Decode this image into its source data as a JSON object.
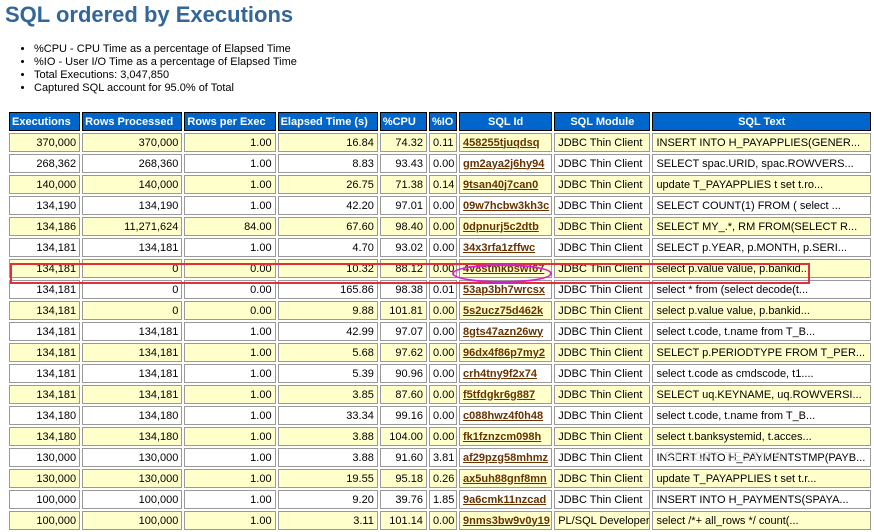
{
  "title": "SQL ordered by Executions",
  "notes": [
    "%CPU - CPU Time as a percentage of Elapsed Time",
    "%IO - User I/O Time as a percentage of Elapsed Time",
    "Total Executions: 3,047,850",
    "Captured SQL account for 95.0% of Total"
  ],
  "columns": [
    "Executions",
    "Rows Processed",
    "Rows per Exec",
    "Elapsed Time (s)",
    "%CPU",
    "%IO",
    "SQL Id",
    "SQL Module",
    "SQL Text"
  ],
  "rows": [
    [
      "370,000",
      "370,000",
      "1.00",
      "16.84",
      "74.32",
      "0.11",
      "458255tjuqdsq",
      "JDBC Thin Client",
      "INSERT INTO H_PAYAPPLIES(GENER..."
    ],
    [
      "268,362",
      "268,360",
      "1.00",
      "8.83",
      "93.43",
      "0.00",
      "gm2aya2j6hy94",
      "JDBC Thin Client",
      "SELECT spac.URID, spac.ROWVERS..."
    ],
    [
      "140,000",
      "140,000",
      "1.00",
      "26.75",
      "71.38",
      "0.14",
      "9tsan40j7can0",
      "JDBC Thin Client",
      "update T_PAYAPPLIES t set t.ro..."
    ],
    [
      "134,190",
      "134,190",
      "1.00",
      "42.20",
      "97.01",
      "0.00",
      "09w7hcbw3kh3c",
      "JDBC Thin Client",
      "SELECT COUNT(1) FROM ( select ..."
    ],
    [
      "134,186",
      "11,271,624",
      "84.00",
      "67.60",
      "98.40",
      "0.00",
      "0dpnurj5c2dtb",
      "JDBC Thin Client",
      "SELECT MY_.*, RM FROM(SELECT R..."
    ],
    [
      "134,181",
      "134,181",
      "1.00",
      "4.70",
      "93.02",
      "0.00",
      "34x3rfa1zffwc",
      "JDBC Thin Client",
      "SELECT p.YEAR, p.MONTH, p.SERI..."
    ],
    [
      "134,181",
      "0",
      "0.00",
      "10.32",
      "88.12",
      "0.00",
      "4v8stmkbswf67",
      "JDBC Thin Client",
      "select p.value value, p.bankid..."
    ],
    [
      "134,181",
      "0",
      "0.00",
      "165.86",
      "98.38",
      "0.01",
      "53ap3bh7wrcsx",
      "JDBC Thin Client",
      "select * from (select decode(t..."
    ],
    [
      "134,181",
      "0",
      "0.00",
      "9.88",
      "101.81",
      "0.00",
      "5s2ucz75d462k",
      "JDBC Thin Client",
      "select p.value value, p.bankid..."
    ],
    [
      "134,181",
      "134,181",
      "1.00",
      "42.99",
      "97.07",
      "0.00",
      "8gts47azn26wy",
      "JDBC Thin Client",
      "select t.code, t.name from T_B..."
    ],
    [
      "134,181",
      "134,181",
      "1.00",
      "5.68",
      "97.62",
      "0.00",
      "96dx4f86p7my2",
      "JDBC Thin Client",
      "SELECT p.PERIODTYPE FROM T_PER..."
    ],
    [
      "134,181",
      "134,181",
      "1.00",
      "5.39",
      "90.96",
      "0.00",
      "crh4tny9f2x74",
      "JDBC Thin Client",
      "select t.code as cmdscode, t1...."
    ],
    [
      "134,181",
      "134,181",
      "1.00",
      "3.85",
      "87.60",
      "0.00",
      "f5tfdgkr6g887",
      "JDBC Thin Client",
      "SELECT uq.KEYNAME, uq.ROWVERSI..."
    ],
    [
      "134,180",
      "134,180",
      "1.00",
      "33.34",
      "99.16",
      "0.00",
      "c088hwz4f0h48",
      "JDBC Thin Client",
      "select t.code, t.name from T_B..."
    ],
    [
      "134,180",
      "134,180",
      "1.00",
      "3.88",
      "104.00",
      "0.00",
      "fk1fznzcm098h",
      "JDBC Thin Client",
      "select t.banksystemid, t.acces..."
    ],
    [
      "130,000",
      "130,000",
      "1.00",
      "3.88",
      "91.60",
      "3.81",
      "af29pzg58mhmz",
      "JDBC Thin Client",
      "INSERT INTO H_PAYMENTSTMP(PAYB..."
    ],
    [
      "130,000",
      "130,000",
      "1.00",
      "19.55",
      "95.18",
      "0.26",
      "ax5uh88gnf8mn",
      "JDBC Thin Client",
      "update T_PAYAPPLIES t set t.r..."
    ],
    [
      "100,000",
      "100,000",
      "1.00",
      "9.20",
      "39.76",
      "1.85",
      "9a6cmk11nzcad",
      "JDBC Thin Client",
      "INSERT INTO H_PAYMENTS(SPAYA..."
    ],
    [
      "100,000",
      "100,000",
      "1.00",
      "3.11",
      "101.14",
      "0.00",
      "9nms3bw9v0y19",
      "PL/SQL Developer",
      "select /*+ all_rows */ count(..."
    ]
  ],
  "watermark": "ERSOFT TESTING",
  "colors": {
    "header_bg": "#0066cc",
    "title": "#336699",
    "odd_row": "#ffffcc",
    "highlight_row": "#e0303a",
    "highlight_id": "#d022d0"
  }
}
